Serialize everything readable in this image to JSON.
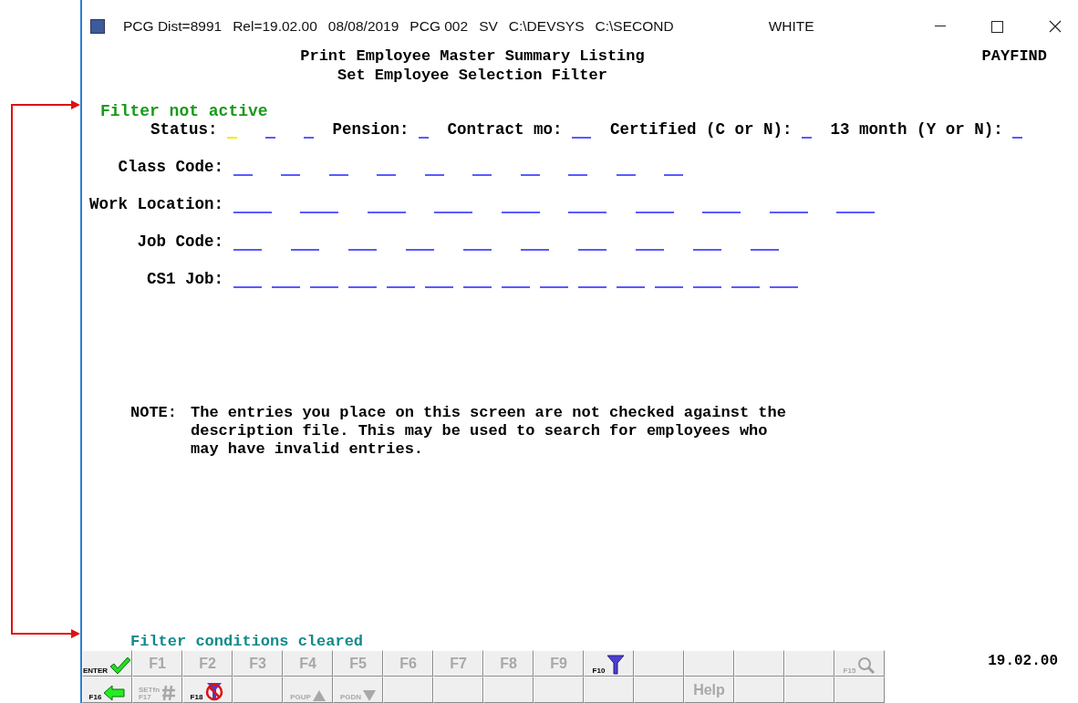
{
  "window": {
    "title_parts": [
      "PCG Dist=8991",
      "Rel=19.02.00",
      "08/08/2019",
      "PCG 002",
      "SV",
      "C:\\DEVSYS",
      "C:\\SECOND",
      "WHITE"
    ]
  },
  "header": {
    "lines": [
      "Print Employee Master Summary Listing",
      "Set Employee Selection Filter"
    ],
    "program": "PAYFIND"
  },
  "filter_status": "Filter not active",
  "status_row": [
    {
      "label": "Status:",
      "fields": [
        {
          "focused": true
        },
        {
          "focused": false
        },
        {
          "focused": false
        }
      ]
    },
    {
      "label": "Pension:",
      "fields": [
        {
          "focused": false
        }
      ]
    },
    {
      "label": "Contract mo:",
      "fields": [
        {
          "focused": false
        }
      ]
    },
    {
      "label": "Certified (C or N):",
      "fields": [
        {
          "focused": false
        }
      ]
    },
    {
      "label": "13 month (Y or N):",
      "fields": [
        {
          "focused": false
        }
      ]
    }
  ],
  "field_rows": [
    {
      "label": "Class Code:",
      "fields": [
        {
          "focused": false
        },
        {
          "focused": false
        },
        {
          "focused": false
        },
        {
          "focused": false
        },
        {
          "focused": false
        },
        {
          "focused": false
        },
        {
          "focused": false
        },
        {
          "focused": false
        },
        {
          "focused": false
        },
        {
          "focused": false
        }
      ]
    },
    {
      "label": "Work Location:",
      "fields": [
        {
          "focused": false
        },
        {
          "focused": false
        },
        {
          "focused": false
        },
        {
          "focused": false
        },
        {
          "focused": false
        },
        {
          "focused": false
        },
        {
          "focused": false
        },
        {
          "focused": false
        },
        {
          "focused": false
        },
        {
          "focused": false
        }
      ]
    },
    {
      "label": "Job Code:",
      "fields": [
        {
          "focused": false
        },
        {
          "focused": false
        },
        {
          "focused": false
        },
        {
          "focused": false
        },
        {
          "focused": false
        },
        {
          "focused": false
        },
        {
          "focused": false
        },
        {
          "focused": false
        },
        {
          "focused": false
        },
        {
          "focused": false
        }
      ]
    },
    {
      "label": "CS1 Job:",
      "fields": [
        {
          "focused": false
        },
        {
          "focused": false
        },
        {
          "focused": false
        },
        {
          "focused": false
        },
        {
          "focused": false
        },
        {
          "focused": false
        },
        {
          "focused": false
        },
        {
          "focused": false
        },
        {
          "focused": false
        },
        {
          "focused": false
        },
        {
          "focused": false
        },
        {
          "focused": false
        },
        {
          "focused": false
        },
        {
          "focused": false
        },
        {
          "focused": false
        }
      ]
    }
  ],
  "note": {
    "label": "NOTE:",
    "lines": [
      "The entries you place on this screen are not checked against the",
      "description file. This may be used to search for employees who",
      "may have invalid entries."
    ]
  },
  "message": "Filter conditions cleared",
  "function_keys": [
    [
      {
        "kind": "enter",
        "label": "ENTER",
        "disabled": false
      },
      {
        "kind": "text",
        "label": "F1",
        "disabled": true
      },
      {
        "kind": "text",
        "label": "F2",
        "disabled": true
      },
      {
        "kind": "text",
        "label": "F3",
        "disabled": true
      },
      {
        "kind": "text",
        "label": "F4",
        "disabled": true
      },
      {
        "kind": "text",
        "label": "F5",
        "disabled": true
      },
      {
        "kind": "text",
        "label": "F6",
        "disabled": true
      },
      {
        "kind": "text",
        "label": "F7",
        "disabled": true
      },
      {
        "kind": "text",
        "label": "F8",
        "disabled": true
      },
      {
        "kind": "text",
        "label": "F9",
        "disabled": true
      },
      {
        "kind": "filter",
        "label": "F10",
        "disabled": false
      },
      {
        "kind": "blank"
      },
      {
        "kind": "blank"
      },
      {
        "kind": "blank"
      },
      {
        "kind": "blank"
      },
      {
        "kind": "search",
        "label": "F15",
        "disabled": true
      }
    ],
    [
      {
        "kind": "back",
        "label": "F16",
        "disabled": false
      },
      {
        "kind": "set",
        "label": "F17",
        "sublabel": "SETfn",
        "disabled": true
      },
      {
        "kind": "clearfilter",
        "label": "F18",
        "disabled": false
      },
      {
        "kind": "blank"
      },
      {
        "kind": "pgup",
        "label": "PGUP",
        "disabled": true
      },
      {
        "kind": "pgdn",
        "label": "PGDN",
        "disabled": true
      },
      {
        "kind": "blank"
      },
      {
        "kind": "blank"
      },
      {
        "kind": "blank"
      },
      {
        "kind": "blank"
      },
      {
        "kind": "blank"
      },
      {
        "kind": "blank"
      },
      {
        "kind": "text",
        "label": "Help",
        "disabled": true
      },
      {
        "kind": "blank"
      },
      {
        "kind": "blank"
      },
      {
        "kind": "blank"
      }
    ]
  ],
  "version": "19.02.00"
}
